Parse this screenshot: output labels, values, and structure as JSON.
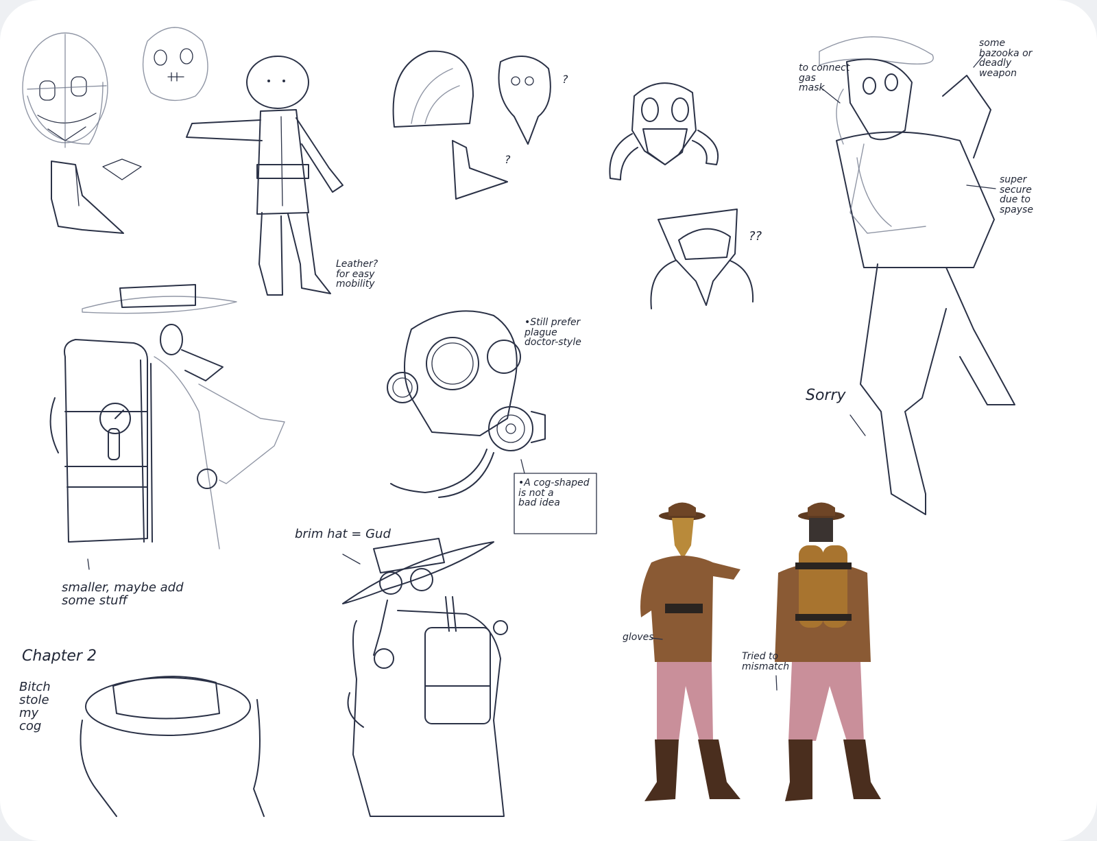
{
  "notes": {
    "leather": "Leather?\nfor easy\nmobility",
    "plague": "•Still prefer\nplague\ndoctor-style",
    "cog": "•A cog-shaped\nis not a\nbad idea",
    "smaller": "smaller, maybe add\nsome stuff",
    "brim_hat": "brim hat = Gud",
    "chapter": "Chapter 2",
    "bitch": "Bitch\nstole\nmy\ncog",
    "connect": "to connect\ngas\nmask",
    "bazooka": "some\nbazooka or\ndeadly\nweapon",
    "secure": "super\nsecure\ndue to\nspayse",
    "sorry": "Sorry",
    "gloves": "gloves",
    "mismatch": "Tried to\nmismatch",
    "q1": "?",
    "q2": "?",
    "q3": "??"
  },
  "colors": {
    "ink": "#2a3146",
    "coat": "#8a5a34",
    "pants": "#c98f9a",
    "boots": "#4a2e1e",
    "hat": "#6e4526",
    "mask": "#b98a3a",
    "tank": "#a8742f"
  }
}
